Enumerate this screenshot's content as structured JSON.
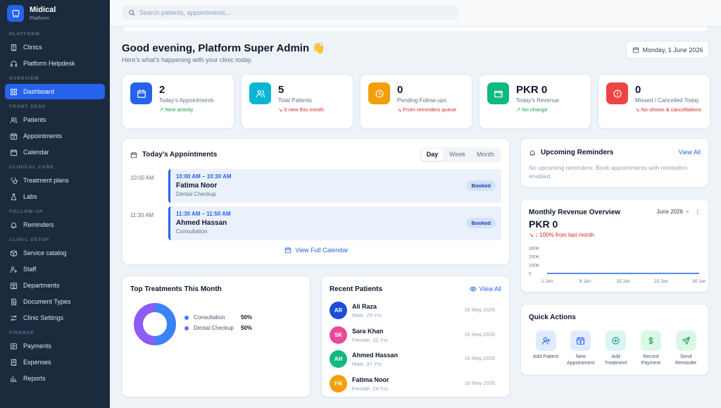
{
  "brand": {
    "name": "Midical",
    "sub": "Platform"
  },
  "sidebar": {
    "sections": [
      {
        "title": "PLATFORM",
        "items": [
          {
            "label": "Clinics",
            "icon": "building-icon"
          },
          {
            "label": "Platform Helpdesk",
            "icon": "headset-icon"
          }
        ]
      },
      {
        "title": "OVERVIEW",
        "items": [
          {
            "label": "Dashboard",
            "icon": "dashboard-icon",
            "active": true
          }
        ]
      },
      {
        "title": "FRONT DESK",
        "items": [
          {
            "label": "Patients",
            "icon": "users-icon"
          },
          {
            "label": "Appointments",
            "icon": "calendar-check-icon"
          },
          {
            "label": "Calendar",
            "icon": "calendar-icon"
          }
        ]
      },
      {
        "title": "CLINICAL CARE",
        "items": [
          {
            "label": "Treatment plans",
            "icon": "stethoscope-icon"
          },
          {
            "label": "Labs",
            "icon": "flask-icon"
          }
        ]
      },
      {
        "title": "FOLLOW-UP",
        "items": [
          {
            "label": "Reminders",
            "icon": "bell-icon"
          }
        ]
      },
      {
        "title": "CLINIC SETUP",
        "items": [
          {
            "label": "Service catalog",
            "icon": "box-icon"
          },
          {
            "label": "Staff",
            "icon": "user-cog-icon"
          },
          {
            "label": "Departments",
            "icon": "departments-icon"
          },
          {
            "label": "Document Types",
            "icon": "document-icon"
          },
          {
            "label": "Clinic Settings",
            "icon": "sliders-icon"
          }
        ]
      },
      {
        "title": "FINANCE",
        "items": [
          {
            "label": "Payments",
            "icon": "payments-icon"
          },
          {
            "label": "Expenses",
            "icon": "receipt-icon"
          },
          {
            "label": "Reports",
            "icon": "chart-icon"
          }
        ]
      }
    ]
  },
  "search": {
    "placeholder": "Search patients, appointments..."
  },
  "greeting": {
    "title": "Good evening, Platform Super Admin 👋",
    "subtitle": "Here's what's happening with your clinic today.",
    "date": "Monday, 1 June 2026"
  },
  "stats": [
    {
      "value": "2",
      "label": "Today's Appointments",
      "note": "↗ New activity",
      "tone": "green",
      "color": "#2563eb",
      "icon": "calendar-icon"
    },
    {
      "value": "5",
      "label": "Total Patients",
      "note": "↘ 0 new this month",
      "tone": "red",
      "color": "#06b6d4",
      "icon": "users-icon"
    },
    {
      "value": "0",
      "label": "Pending Follow-ups",
      "note": "↘ From reminders queue",
      "tone": "red",
      "color": "#f59e0b",
      "icon": "clock-icon"
    },
    {
      "value": "PKR 0",
      "label": "Today's Revenue",
      "note": "↗ No change",
      "tone": "green",
      "color": "#10b981",
      "icon": "wallet-icon"
    },
    {
      "value": "0",
      "label": "Missed / Cancelled Today",
      "note": "↘ No-shows & cancellations",
      "tone": "red",
      "color": "#ef4444",
      "icon": "alert-icon"
    }
  ],
  "appointments": {
    "title": "Today's Appointments",
    "tabs": [
      "Day",
      "Week",
      "Month"
    ],
    "items": [
      {
        "time": "10:00 AM",
        "range": "10:00 AM – 10:30 AM",
        "name": "Fatima Noor",
        "type": "Dental Checkup",
        "status": "Booked"
      },
      {
        "time": "11:30 AM",
        "range": "11:30 AM – 11:50 AM",
        "name": "Ahmed Hassan",
        "type": "Consultation",
        "status": "Booked"
      }
    ],
    "view_full": "View Full Calendar"
  },
  "reminders": {
    "title": "Upcoming Reminders",
    "view_all": "View All",
    "empty": "No upcoming reminders. Book appointments with reminders enabled."
  },
  "revenue": {
    "title": "Monthly Revenue Overview",
    "period": "June 2026",
    "amount": "PKR 0",
    "change": "↘ ↓ 100% from last month"
  },
  "treatments": {
    "title": "Top Treatments This Month"
  },
  "chart_data": [
    {
      "type": "pie",
      "title": "Top Treatments This Month",
      "categories": [
        "Consultation",
        "Dental Checkup"
      ],
      "values": [
        50,
        50
      ],
      "labels": [
        "50%",
        "50%"
      ],
      "colors": [
        "#3b82f6",
        "#8b5cf6"
      ],
      "legend": "right"
    },
    {
      "type": "line",
      "title": "Monthly Revenue Overview",
      "x": [
        "1 Jun",
        "8 Jun",
        "15 Jun",
        "22 Jun",
        "30 Jun"
      ],
      "y_ticks": [
        "300K",
        "200K",
        "100K",
        "0"
      ],
      "series": [
        {
          "values": [
            0,
            0,
            0,
            0,
            0
          ]
        }
      ],
      "ylim": [
        0,
        300000
      ],
      "grid": false,
      "color": "#2563eb"
    }
  ],
  "recent_patients": {
    "title": "Recent Patients",
    "view_all": "View All",
    "items": [
      {
        "initials": "AR",
        "name": "Ali Raza",
        "meta": "Male, 29 Yrs",
        "date": "16 May 2026",
        "color": "#1d4ed8"
      },
      {
        "initials": "SK",
        "name": "Sara Khan",
        "meta": "Female, 32 Yrs",
        "date": "16 May 2026",
        "color": "#ec4899"
      },
      {
        "initials": "AH",
        "name": "Ahmed Hassan",
        "meta": "Male, 37 Yrs",
        "date": "16 May 2026",
        "color": "#10b981"
      },
      {
        "initials": "FN",
        "name": "Fatima Noor",
        "meta": "Female, 24 Yrs",
        "date": "16 May 2026",
        "color": "#f59e0b"
      }
    ]
  },
  "quick_actions": {
    "title": "Quick Actions",
    "items": [
      {
        "label": "Add Patient",
        "bg": "#e0ecfd",
        "fg": "#2563eb",
        "icon": "user-plus-icon"
      },
      {
        "label": "New Appointment",
        "bg": "#e0ecfd",
        "fg": "#2563eb",
        "icon": "calendar-plus-icon"
      },
      {
        "label": "Add Treatment",
        "bg": "#dcf5f2",
        "fg": "#0d9488",
        "icon": "plus-circle-icon"
      },
      {
        "label": "Record Payment",
        "bg": "#dcf7e7",
        "fg": "#16a34a",
        "icon": "dollar-icon"
      },
      {
        "label": "Send Reminder",
        "bg": "#dcf7e7",
        "fg": "#16a34a",
        "icon": "send-icon"
      }
    ]
  }
}
